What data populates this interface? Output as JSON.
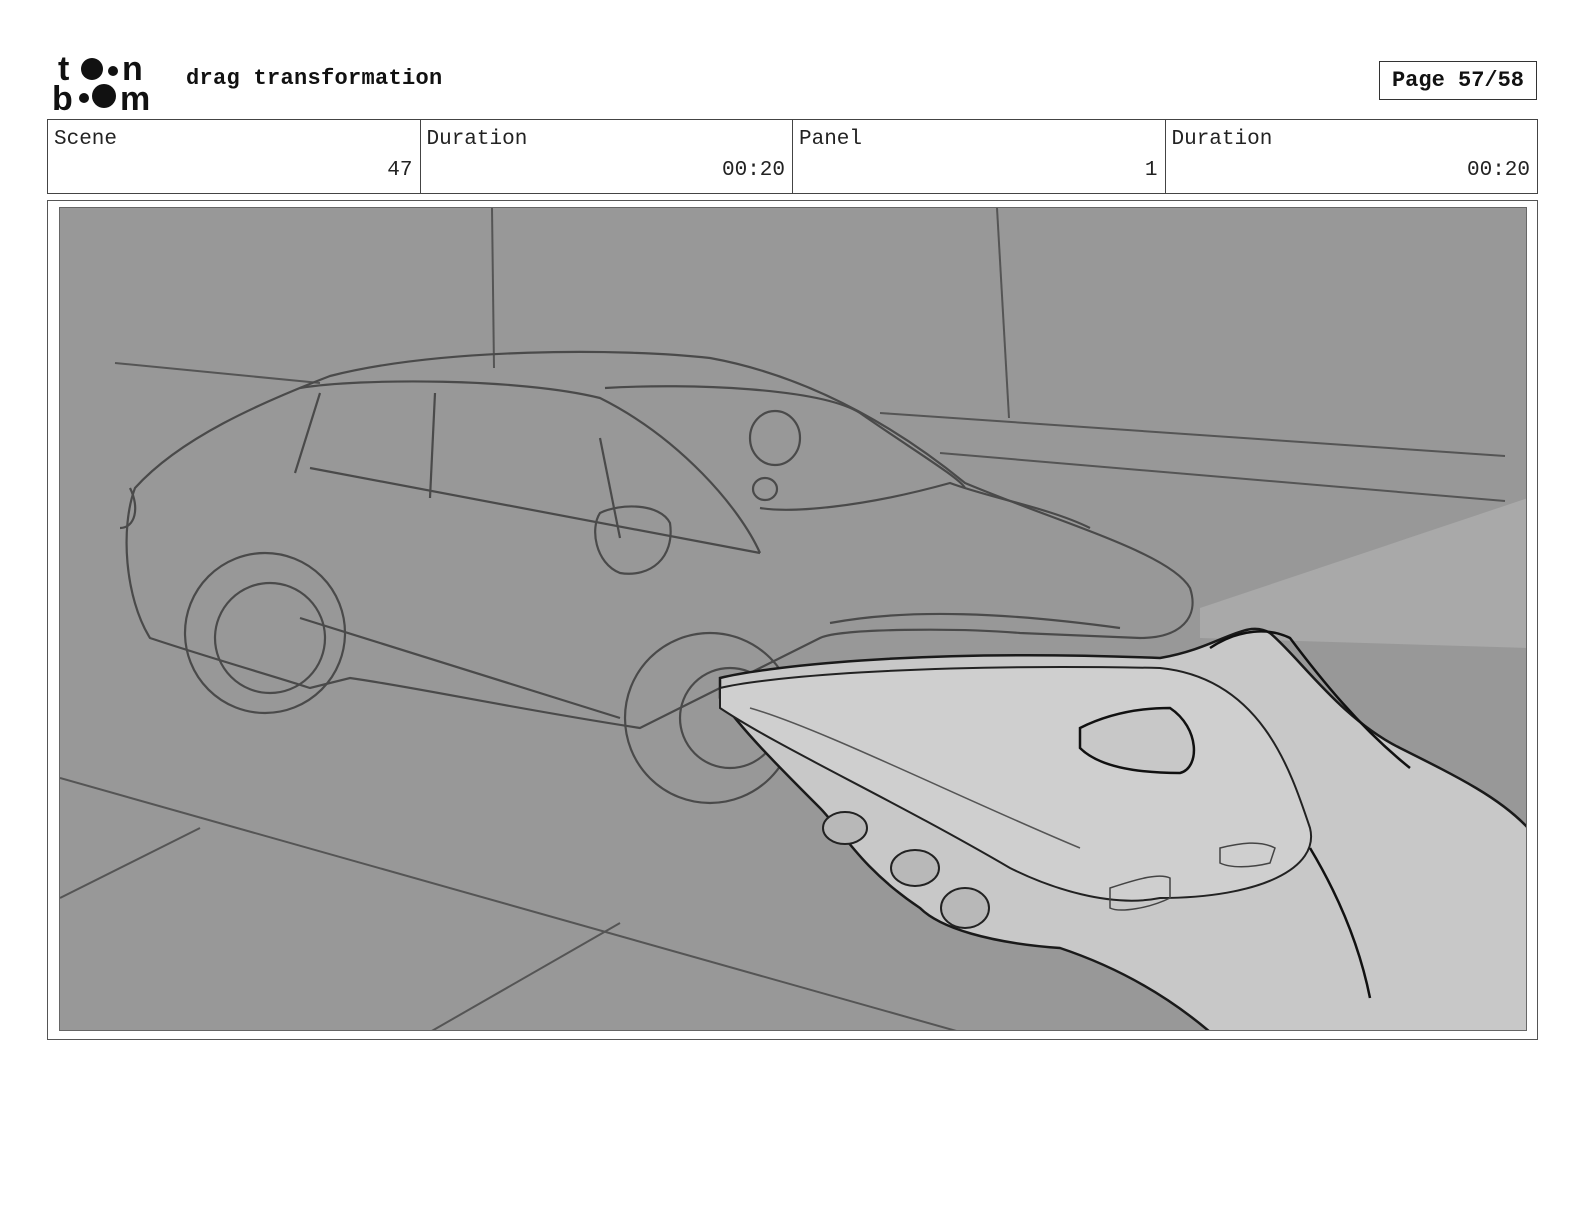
{
  "header": {
    "logo_text": "toon boom",
    "project_title": "drag transformation",
    "page_label": "Page 57/58"
  },
  "info": {
    "scene_label": "Scene",
    "scene_value": "47",
    "scene_duration_label": "Duration",
    "scene_duration_value": "00:20",
    "panel_label": "Panel",
    "panel_value": "1",
    "panel_duration_label": "Duration",
    "panel_duration_value": "00:20"
  },
  "panel": {
    "description": ""
  },
  "colors": {
    "background": "#989898",
    "phone_hand": "#c8c8c8",
    "line": "#333333"
  }
}
